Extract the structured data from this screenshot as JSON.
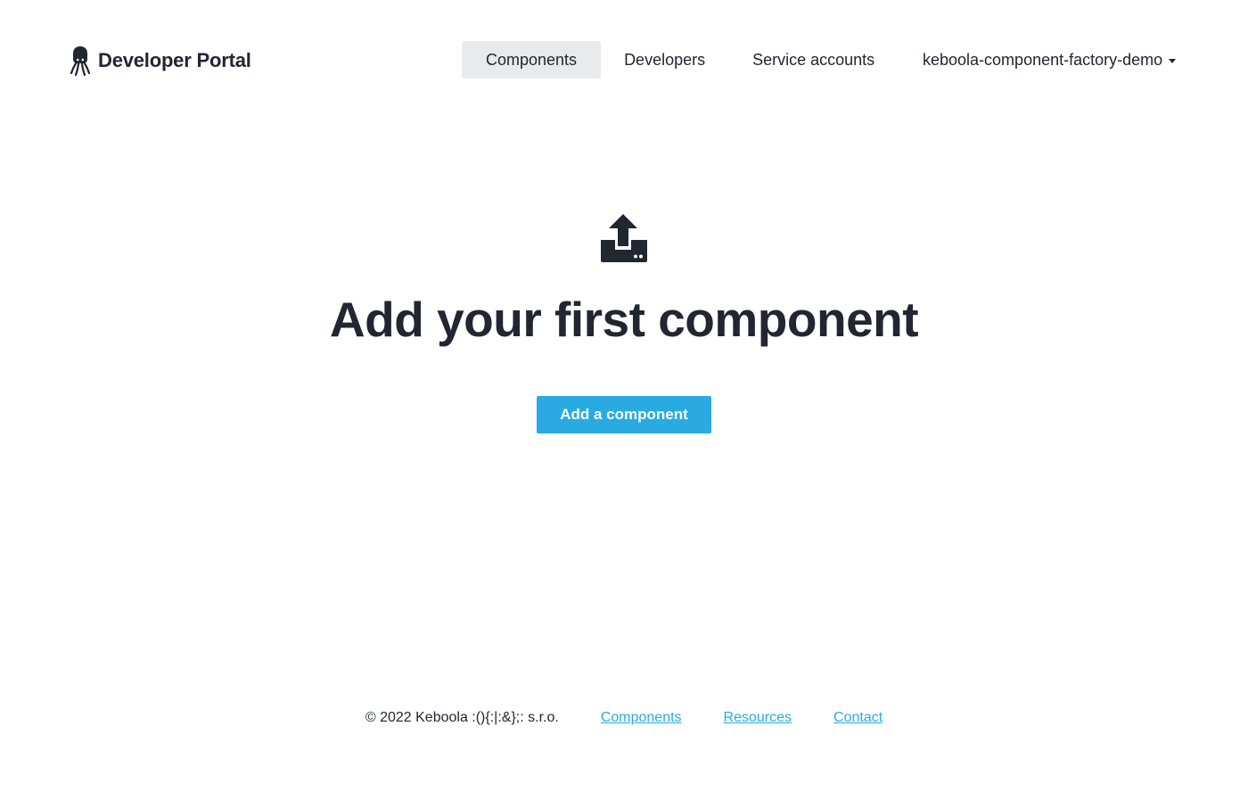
{
  "brand": {
    "title": "Developer Portal",
    "logo_icon": "octopus-logo-icon"
  },
  "nav": {
    "items": [
      {
        "label": "Components",
        "active": true
      },
      {
        "label": "Developers",
        "active": false
      },
      {
        "label": "Service accounts",
        "active": false
      }
    ]
  },
  "account": {
    "vendor_name": "keboola-component-factory-demo",
    "dropdown_icon": "caret-down-icon"
  },
  "empty_state": {
    "icon": "upload-icon",
    "title": "Add your first component",
    "button_label": "Add a component"
  },
  "footer": {
    "copyright": "© 2022 Keboola :(){:|:&};: s.r.o.",
    "links": [
      "Components",
      "Resources",
      "Contact"
    ]
  },
  "colors": {
    "text": "#222631",
    "accent": "#29abe2",
    "nav_active_bg": "#e9eaeb"
  }
}
